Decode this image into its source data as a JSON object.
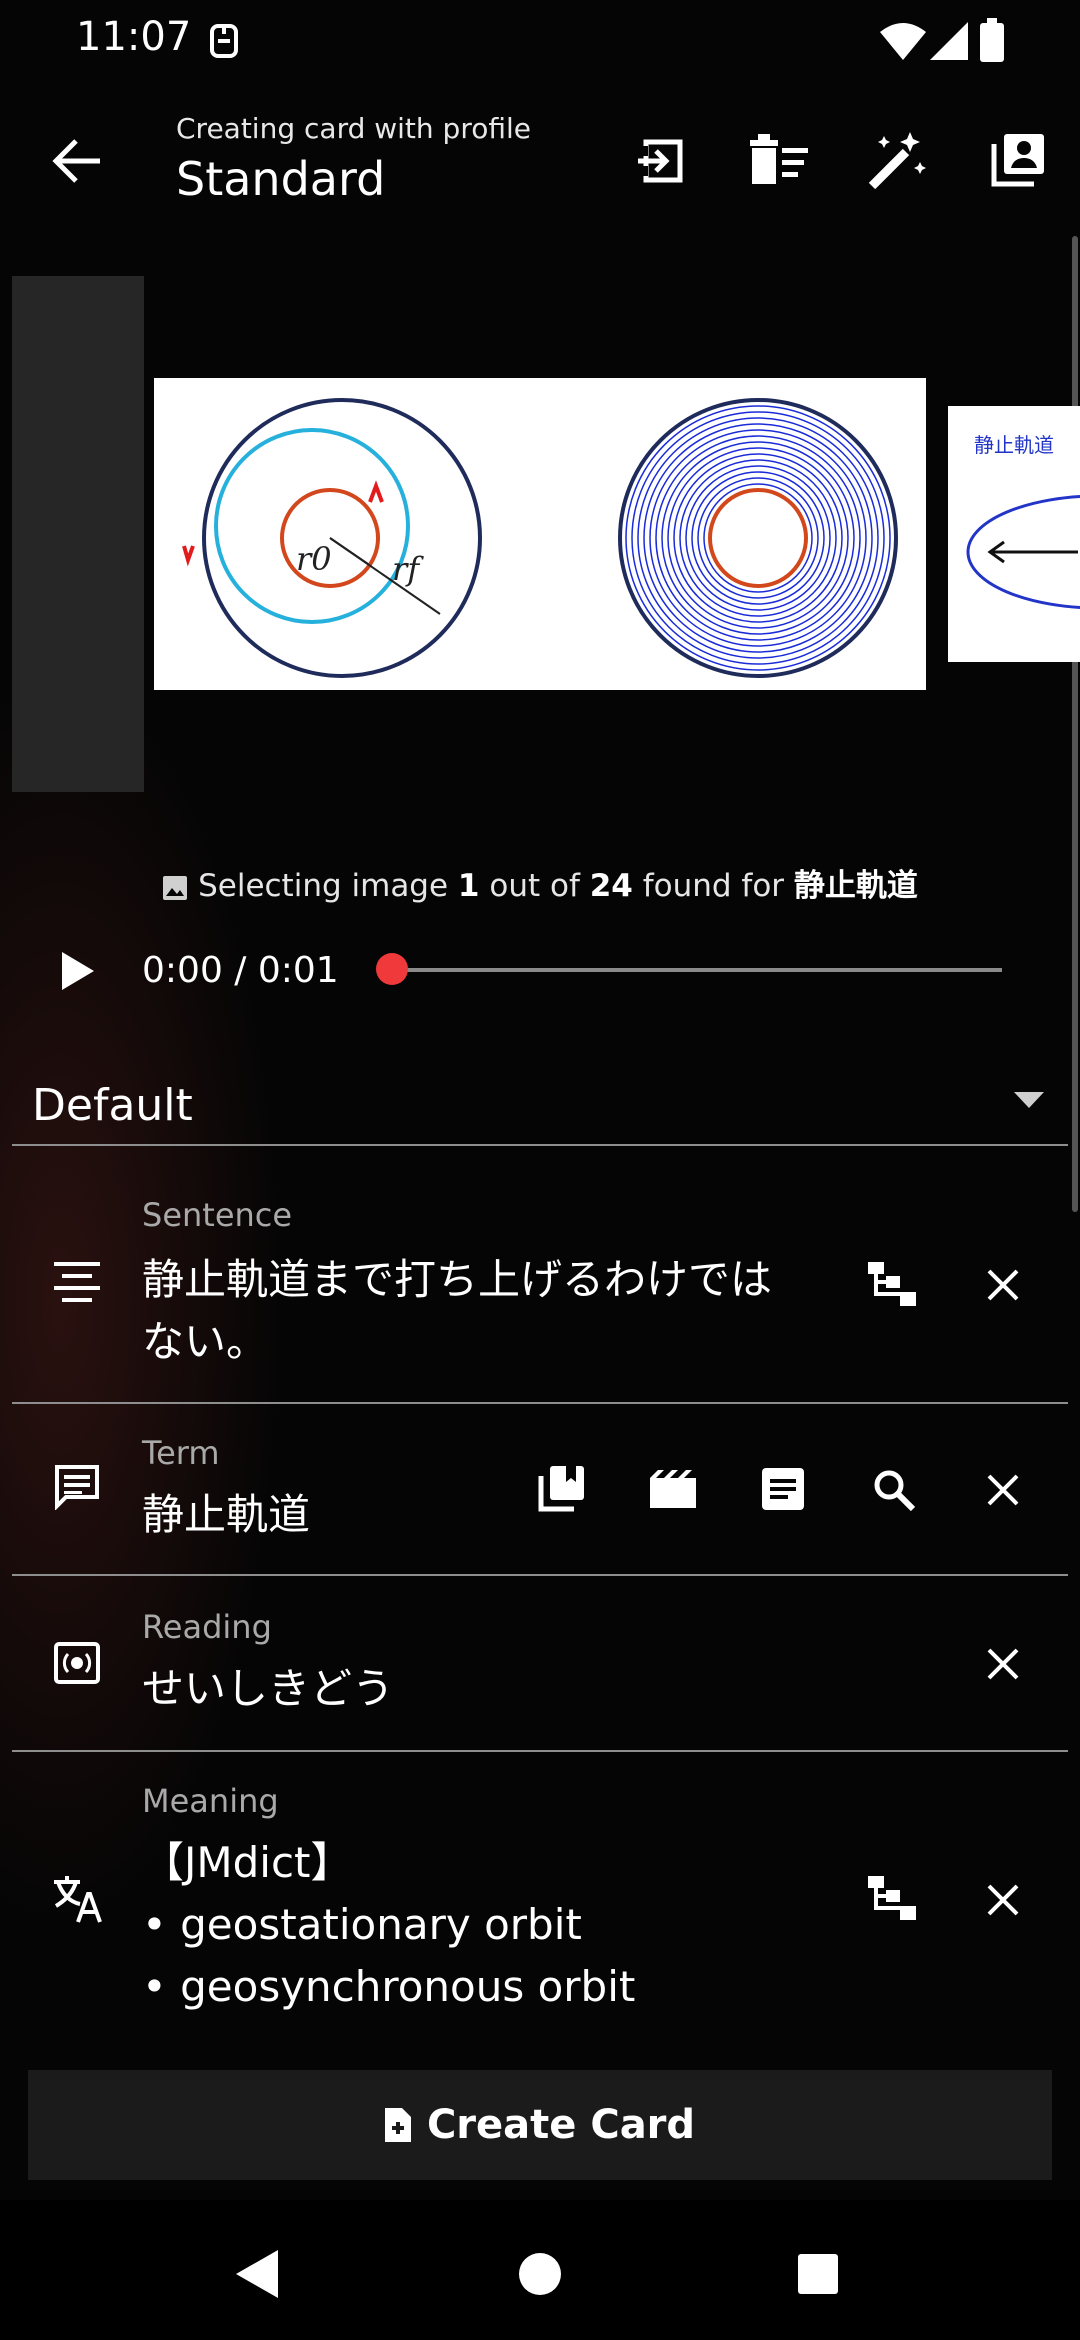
{
  "status_bar": {
    "time": "11:07"
  },
  "app_bar": {
    "subtitle": "Creating card with profile",
    "title": "Standard",
    "actions": [
      "export-icon",
      "clear-fields-icon",
      "auto-fill-wand-icon",
      "profile-cards-icon"
    ]
  },
  "carousel": {
    "images": [
      {
        "name": "placeholder-image"
      },
      {
        "name": "orbit-diagram-image",
        "labels": [
          "r0",
          "rf"
        ]
      },
      {
        "name": "static-orbit-image",
        "label": "静止軌道"
      }
    ]
  },
  "image_info": {
    "prefix": "Selecting image ",
    "current": "1",
    "middle": " out of ",
    "total": "24",
    "suffix": " found for ",
    "query": "静止軌道"
  },
  "player": {
    "time": "0:00 / 0:01",
    "progress": 0
  },
  "deck": {
    "name": "Default"
  },
  "fields": {
    "sentence": {
      "label": "Sentence",
      "value_line1": "静止軌道まで打ち上げるわけでは",
      "value_line2": "ない。"
    },
    "term": {
      "label": "Term",
      "value": "静止軌道"
    },
    "reading": {
      "label": "Reading",
      "value": "せいしきどう"
    },
    "meaning": {
      "label": "Meaning",
      "line1": "【JMdict】",
      "line2": "• geostationary orbit",
      "line3": "• geosynchronous orbit"
    }
  },
  "create_button": {
    "label": "Create Card"
  },
  "colors": {
    "accent_red": "#f0393a",
    "background": "#000000",
    "button_bg": "#1b1b1b"
  }
}
